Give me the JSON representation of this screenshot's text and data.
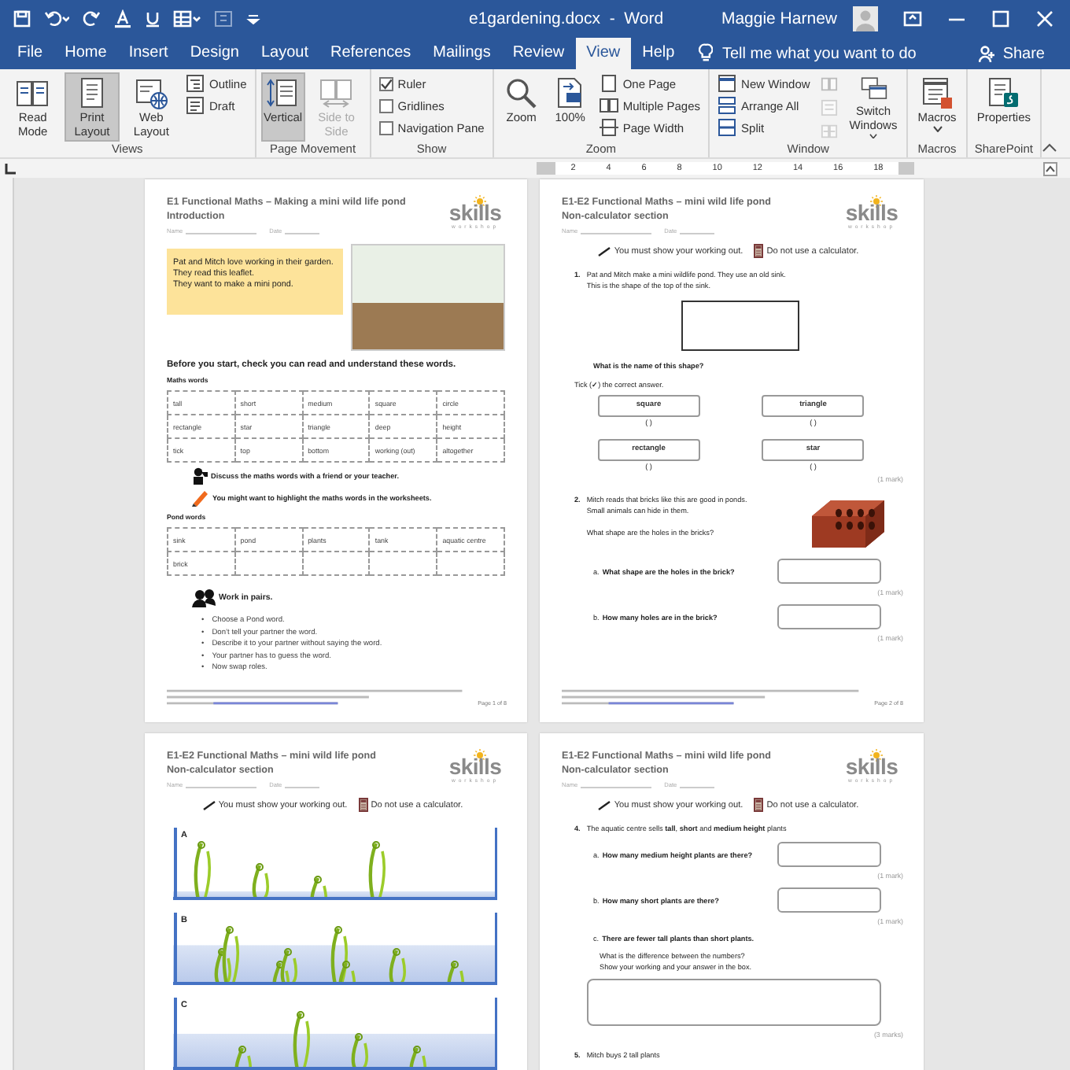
{
  "title_bar": {
    "title": "e1gardening.docx  -  Word",
    "user": "Maggie Harnew"
  },
  "menu_tabs": [
    {
      "label": "File",
      "selected": false
    },
    {
      "label": "Home",
      "selected": false
    },
    {
      "label": "Insert",
      "selected": false
    },
    {
      "label": "Design",
      "selected": false
    },
    {
      "label": "Layout",
      "selected": false
    },
    {
      "label": "References",
      "selected": false
    },
    {
      "label": "Mailings",
      "selected": false
    },
    {
      "label": "Review",
      "selected": false
    },
    {
      "label": "View",
      "selected": true
    },
    {
      "label": "Help",
      "selected": false
    }
  ],
  "tell_me": {
    "placeholder": "Tell me what you want to do"
  },
  "share": "Share",
  "ribbon": {
    "groups": [
      {
        "label": "Views",
        "items": [
          {
            "kind": "large",
            "label": "Read Mode",
            "selected": false,
            "disabled": false,
            "dropdown": false
          },
          {
            "kind": "large",
            "label": "Print Layout",
            "selected": true,
            "disabled": false,
            "dropdown": false
          },
          {
            "kind": "large",
            "label": "Web Layout",
            "selected": false,
            "disabled": false,
            "dropdown": false
          },
          {
            "kind": "small",
            "label": "Outline",
            "disabled": false
          },
          {
            "kind": "small",
            "label": "Draft",
            "disabled": false
          }
        ]
      },
      {
        "label": "Page Movement",
        "items": [
          {
            "kind": "large",
            "label": "Vertical",
            "selected": true,
            "disabled": false,
            "dropdown": false
          },
          {
            "kind": "large",
            "label": "Side to Side",
            "selected": false,
            "disabled": true,
            "dropdown": false
          }
        ]
      },
      {
        "label": "Show",
        "items": [
          {
            "kind": "check",
            "label": "Ruler",
            "checked": true
          },
          {
            "kind": "check",
            "label": "Gridlines",
            "checked": false
          },
          {
            "kind": "check",
            "label": "Navigation Pane",
            "checked": false
          }
        ]
      },
      {
        "label": "Zoom",
        "items": [
          {
            "kind": "large",
            "label": "Zoom",
            "selected": false,
            "disabled": false,
            "dropdown": false
          },
          {
            "kind": "large",
            "label": "100%",
            "selected": false,
            "disabled": false,
            "dropdown": false
          },
          {
            "kind": "small",
            "label": "One Page",
            "disabled": false
          },
          {
            "kind": "small",
            "label": "Multiple Pages",
            "disabled": false
          },
          {
            "kind": "small",
            "label": "Page Width",
            "disabled": false
          }
        ]
      },
      {
        "label": "Window",
        "items": [
          {
            "kind": "small",
            "label": "New Window",
            "disabled": false
          },
          {
            "kind": "small",
            "label": "Arrange All",
            "disabled": false
          },
          {
            "kind": "small",
            "label": "Split",
            "disabled": false
          },
          {
            "kind": "icon",
            "disabled": true
          },
          {
            "kind": "icon",
            "disabled": true
          },
          {
            "kind": "icon",
            "disabled": true
          },
          {
            "kind": "large",
            "label": "Switch Windows",
            "selected": false,
            "disabled": false,
            "dropdown": true
          }
        ]
      },
      {
        "label": "Macros",
        "items": [
          {
            "kind": "large",
            "label": "Macros",
            "selected": false,
            "disabled": false,
            "dropdown": true
          }
        ]
      },
      {
        "label": "SharePoint",
        "items": [
          {
            "kind": "large",
            "label": "Properties",
            "selected": false,
            "disabled": false,
            "dropdown": false
          }
        ]
      }
    ]
  },
  "ruler": {
    "labels": [
      "2",
      "4",
      "6",
      "8",
      "10",
      "12",
      "14",
      "16",
      "18"
    ]
  },
  "pages": [
    {
      "title": "E1 Functional Maths – Making a mini wild life pond",
      "subtitle": "Introduction",
      "name_label": "Name",
      "date_label": "Date",
      "logo": {
        "name": "skills",
        "tagline": "workshop"
      },
      "blocks": [
        {
          "kind": "intro",
          "lines": [
            "Pat and Mitch love working in their garden.",
            "They read this leaflet.",
            "They want to make a mini pond."
          ]
        },
        {
          "kind": "heading",
          "text": "Before you start, check you can read and understand these words."
        },
        {
          "kind": "label",
          "text": "Maths words"
        },
        {
          "kind": "table",
          "rows": [
            [
              "tall",
              "short",
              "medium",
              "square",
              "circle"
            ],
            [
              "rectangle",
              "star",
              "triangle",
              "deep",
              "height"
            ],
            [
              "tick",
              "top",
              "bottom",
              "working (out)",
              "altogether"
            ]
          ]
        },
        {
          "kind": "discuss",
          "text": "Discuss the maths words with a friend or your teacher."
        },
        {
          "kind": "highlight",
          "text": "You might want to highlight the maths words in the worksheets."
        },
        {
          "kind": "label",
          "text": "Pond words"
        },
        {
          "kind": "table",
          "rows": [
            [
              "sink",
              "pond",
              "plants",
              "tank",
              "aquatic centre"
            ],
            [
              "brick"
            ]
          ]
        },
        {
          "kind": "pairs",
          "text": "Work in pairs."
        },
        {
          "kind": "bullets",
          "items": [
            {
              "marker": "•",
              "text": "Choose a Pond word."
            },
            {
              "marker": "•",
              "text": "Don’t tell your partner the word."
            },
            {
              "marker": "•",
              "text": "Describe it to your partner without saying the word."
            },
            {
              "marker": "•",
              "text": "Your partner has to guess the word."
            },
            {
              "marker": "•",
              "text": "Now swap roles."
            }
          ]
        },
        {
          "kind": "footer",
          "page": "Page 1 of 8"
        }
      ]
    },
    {
      "title": "E1-E2 Functional Maths – mini wild life pond",
      "subtitle": "Non-calculator section",
      "name_label": "Name",
      "date_label": "Date",
      "logo": {
        "name": "skills",
        "tagline": "workshop"
      },
      "blocks": [
        {
          "kind": "rules",
          "items": [
            "You must show your working out.",
            "Do not use a calculator."
          ]
        },
        {
          "kind": "question",
          "number": "1.",
          "lines": [
            "Pat and Mitch make a mini wildlife pond. They use an old sink.",
            "This is the shape of the top of the sink."
          ]
        },
        {
          "kind": "shape"
        },
        {
          "kind": "heading_small",
          "text": "What is the name of this shape?"
        },
        {
          "kind": "text",
          "text": "Tick (**✓**) the correct answer."
        },
        {
          "kind": "choices",
          "items": [
            {
              "label": "square",
              "bracket": "( )",
              "checked": false
            },
            {
              "label": "triangle",
              "bracket": "( )",
              "checked": false
            },
            {
              "label": "rectangle",
              "bracket": "( )",
              "checked": false
            },
            {
              "label": "star",
              "bracket": "( )",
              "checked": false
            }
          ]
        },
        {
          "kind": "mark",
          "text": "(1 mark)"
        },
        {
          "kind": "brick_question",
          "number": "2.",
          "lines": [
            "Mitch reads that bricks like this are good in ponds.",
            "Small animals can hide in them."
          ],
          "ask": "What shape are the holes in the bricks?"
        },
        {
          "kind": "sub",
          "letter": "a.",
          "text": "What shape are the holes in the brick?",
          "answer_box": true
        },
        {
          "kind": "mark",
          "text": "(1 mark)"
        },
        {
          "kind": "sub",
          "letter": "b.",
          "text": "How many holes are in the brick?",
          "answer_box": true
        },
        {
          "kind": "mark",
          "text": "(1 mark)"
        },
        {
          "kind": "footer",
          "page": "Page 2 of 8"
        }
      ]
    },
    {
      "title": "E1-E2 Functional Maths – mini wild life pond",
      "subtitle": "Non-calculator section",
      "name_label": "Name",
      "date_label": "Date",
      "logo": {
        "name": "skills",
        "tagline": "workshop"
      },
      "blocks": [
        {
          "kind": "rules",
          "items": [
            "You must show your working out.",
            "Do not use a calculator."
          ]
        },
        {
          "kind": "tanks",
          "items": [
            {
              "label": "A"
            },
            {
              "label": "B"
            },
            {
              "label": "C"
            }
          ]
        }
      ]
    },
    {
      "title": "E1-E2 Functional Maths – mini wild life pond",
      "subtitle": "Non-calculator section",
      "name_label": "Name",
      "date_label": "Date",
      "logo": {
        "name": "skills",
        "tagline": "workshop"
      },
      "blocks": [
        {
          "kind": "rules",
          "items": [
            "You must show your working out.",
            "Do not use a calculator."
          ]
        },
        {
          "kind": "question",
          "number": "4.",
          "lines": [
            "The aquatic centre sells **tall**, **short** and **medium height** plants"
          ]
        },
        {
          "kind": "sub",
          "letter": "a.",
          "text": "How many medium height plants are there?",
          "answer_box": true
        },
        {
          "kind": "mark",
          "text": "(1 mark)"
        },
        {
          "kind": "sub",
          "letter": "b.",
          "text": "How many short plants are there?",
          "answer_box": true
        },
        {
          "kind": "mark",
          "text": "(1 mark)"
        },
        {
          "kind": "sub",
          "letter": "c.",
          "text": "There are fewer tall plants than short plants.",
          "answer_box": false
        },
        {
          "kind": "indent_text",
          "lines": [
            "What is the difference between the numbers?",
            "Show your working and your answer in the box."
          ]
        },
        {
          "kind": "big_box"
        },
        {
          "kind": "mark",
          "text": "(3 marks)"
        },
        {
          "kind": "question",
          "number": "5.",
          "lines": [
            "Mitch buys 2 tall plants"
          ]
        }
      ]
    }
  ]
}
